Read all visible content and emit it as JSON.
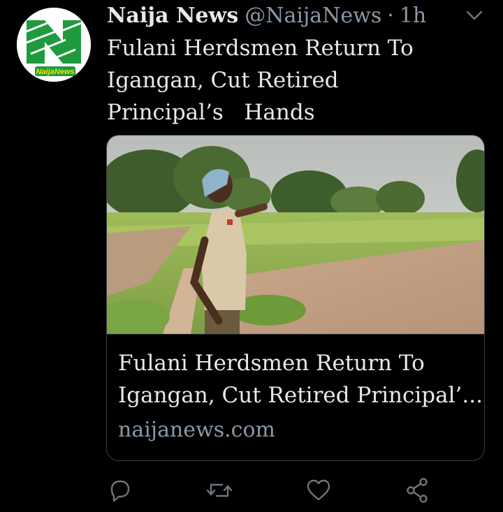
{
  "author": {
    "name": "Naija News",
    "handle": "@NaijaNews",
    "separator": "·",
    "time": "1h",
    "avatar_text": "NaijaNews"
  },
  "tweet": {
    "lines": [
      "Fulani Herdsmen Return To",
      "Igangan, Cut Retired",
      "Principal’s   Hands"
    ]
  },
  "card": {
    "title_lines": [
      "Fulani Herdsmen Return To",
      "Igangan, Cut Retired Principal’..."
    ],
    "domain": "naijanews.com"
  },
  "icons": {
    "caret": "chevron-down-icon",
    "reply": "reply-icon",
    "retweet": "retweet-icon",
    "like": "heart-icon",
    "share": "share-icon"
  },
  "colors": {
    "background": "#000000",
    "text": "#e7e9ea",
    "muted": "#8b98a5",
    "brand_green": "#1f9a3f"
  }
}
